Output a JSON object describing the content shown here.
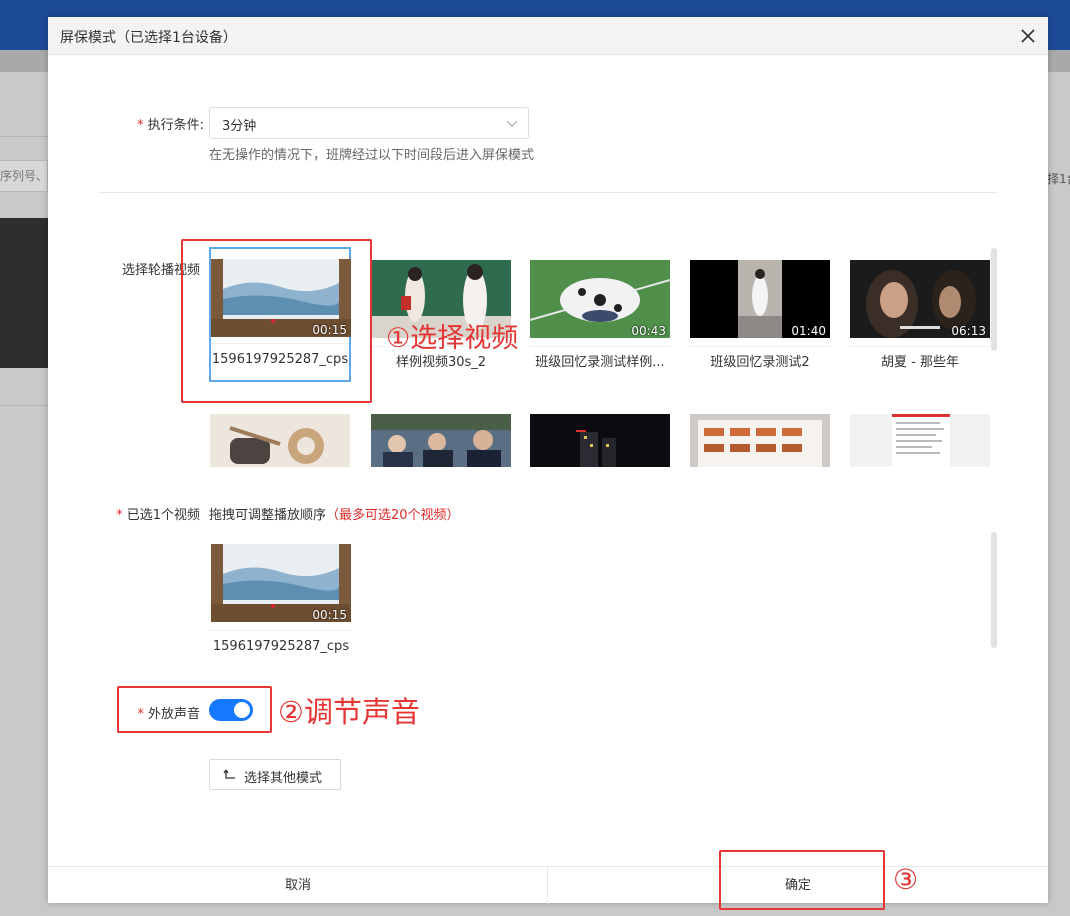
{
  "background": {
    "search_fragment": "序列号、",
    "right_fragment": "择1台"
  },
  "modal": {
    "title": "屏保模式（已选择1台设备）",
    "close_icon": "close-icon"
  },
  "condition": {
    "required_mark": "*",
    "label": "执行条件:",
    "value": "3分钟",
    "hint": "在无操作的情况下，班牌经过以下时间段后进入屏保模式"
  },
  "videos": {
    "label": "选择轮播视频",
    "items": [
      {
        "name": "1596197925287_cps",
        "duration": "00:15",
        "selected": true
      },
      {
        "name": "样例视频30s_2",
        "duration": "",
        "selected": false
      },
      {
        "name": "班级回忆录测试样例...",
        "duration": "00:43",
        "selected": false
      },
      {
        "name": "班级回忆录测试2",
        "duration": "01:40",
        "selected": false
      },
      {
        "name": "胡夏 - 那些年",
        "duration": "06:13",
        "selected": false
      }
    ],
    "row2_count": 5
  },
  "selected": {
    "required_mark": "*",
    "label": "已选1个视频",
    "hint": "拖拽可调整播放顺序",
    "limit": "（最多可选20个视频）",
    "items": [
      {
        "name": "1596197925287_cps",
        "duration": "00:15"
      }
    ]
  },
  "sound": {
    "required_mark": "*",
    "label": "外放声音",
    "enabled": true
  },
  "other_mode_button": "选择其他模式",
  "footer": {
    "cancel": "取消",
    "confirm": "确定"
  },
  "annotations": {
    "step1": "①选择视频",
    "step2": "②调节声音",
    "step3": "③"
  },
  "colors": {
    "accent": "#1677ff",
    "required": "#e02a2a",
    "annotation": "#e53535",
    "selected_border": "#5ea7e8"
  }
}
